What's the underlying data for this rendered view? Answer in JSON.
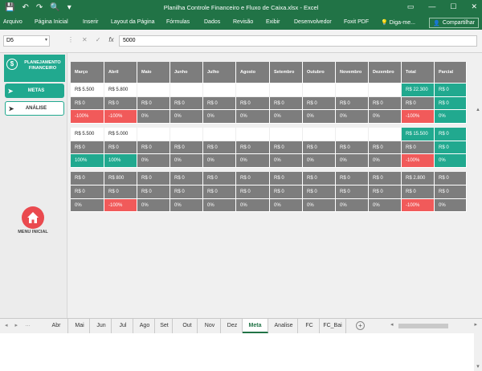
{
  "window": {
    "title": "Planilha Controle Financeiro e Fluxo de Caixa.xlsx - Excel",
    "qat": [
      "💾",
      "↶",
      "↷",
      "🔍",
      "▾"
    ],
    "controls": [
      "▭",
      "—",
      "☐",
      "✕"
    ]
  },
  "ribbon": {
    "tabs": [
      "Arquivo",
      "Página Inicial",
      "Inserir",
      "Layout da Página",
      "Fórmulas",
      "Dados",
      "Revisão",
      "Exibir",
      "Desenvolvedor",
      "Foxit PDF",
      "Diga-me..."
    ],
    "share_label": "Compartilhar"
  },
  "formula_bar": {
    "name_box": "D5",
    "icons": [
      "⋮",
      "✕",
      "✓",
      "fx"
    ],
    "value": "5000"
  },
  "panel": {
    "brand": "PLANEJAMENTO FINANCEIRO",
    "metas_label": "METAS",
    "analise_label": "ANÁLISE",
    "menu_label": "MENU INICIAL"
  },
  "table": {
    "headers": [
      "Março",
      "Abril",
      "Maio",
      "Junho",
      "Julho",
      "Agosto",
      "Setembro",
      "Outubro",
      "Novembro",
      "Dezembro",
      "Total",
      "Parcial"
    ],
    "groups": [
      [
        {
          "cells": [
            "R$ 5.500",
            "R$ 5.800",
            "",
            "",
            "",
            "",
            "",
            "",
            "",
            "",
            "R$ 22.300",
            "R$ 0"
          ],
          "styles": [
            "w",
            "w",
            "w",
            "w",
            "w",
            "w",
            "w",
            "w",
            "w",
            "w",
            "t",
            "t"
          ]
        },
        {
          "cells": [
            "R$ 0",
            "R$ 0",
            "R$ 0",
            "R$ 0",
            "R$ 0",
            "R$ 0",
            "R$ 0",
            "R$ 0",
            "R$ 0",
            "R$ 0",
            "R$ 0",
            "R$ 0"
          ],
          "styles": [
            "g",
            "g",
            "g",
            "g",
            "g",
            "g",
            "g",
            "g",
            "g",
            "g",
            "g",
            "t"
          ]
        },
        {
          "cells": [
            "-100%",
            "-100%",
            "0%",
            "0%",
            "0%",
            "0%",
            "0%",
            "0%",
            "0%",
            "0%",
            "-100%",
            "0%"
          ],
          "styles": [
            "r",
            "r",
            "g",
            "g",
            "g",
            "g",
            "g",
            "g",
            "g",
            "g",
            "r",
            "t"
          ]
        }
      ],
      [
        {
          "cells": [
            "R$ 5.500",
            "R$ 5.000",
            "",
            "",
            "",
            "",
            "",
            "",
            "",
            "",
            "R$ 15.500",
            "R$ 0"
          ],
          "styles": [
            "w",
            "w",
            "w",
            "w",
            "w",
            "w",
            "w",
            "w",
            "w",
            "w",
            "t",
            "t"
          ]
        },
        {
          "cells": [
            "R$ 0",
            "R$ 0",
            "R$ 0",
            "R$ 0",
            "R$ 0",
            "R$ 0",
            "R$ 0",
            "R$ 0",
            "R$ 0",
            "R$ 0",
            "R$ 0",
            "R$ 0"
          ],
          "styles": [
            "g",
            "g",
            "g",
            "g",
            "g",
            "g",
            "g",
            "g",
            "g",
            "g",
            "g",
            "t"
          ]
        },
        {
          "cells": [
            "100%",
            "100%",
            "0%",
            "0%",
            "0%",
            "0%",
            "0%",
            "0%",
            "0%",
            "0%",
            "-100%",
            "0%"
          ],
          "styles": [
            "t",
            "t",
            "g",
            "g",
            "g",
            "g",
            "g",
            "g",
            "g",
            "g",
            "r",
            "t"
          ]
        }
      ],
      [
        {
          "cells": [
            "R$ 0",
            "R$ 800",
            "R$ 0",
            "R$ 0",
            "R$ 0",
            "R$ 0",
            "R$ 0",
            "R$ 0",
            "R$ 0",
            "R$ 0",
            "R$ 2.800",
            "R$ 0"
          ],
          "styles": [
            "g",
            "g",
            "g",
            "g",
            "g",
            "g",
            "g",
            "g",
            "g",
            "g",
            "g",
            "g"
          ]
        },
        {
          "cells": [
            "R$ 0",
            "R$ 0",
            "R$ 0",
            "R$ 0",
            "R$ 0",
            "R$ 0",
            "R$ 0",
            "R$ 0",
            "R$ 0",
            "R$ 0",
            "R$ 0",
            "R$ 0"
          ],
          "styles": [
            "g",
            "g",
            "g",
            "g",
            "g",
            "g",
            "g",
            "g",
            "g",
            "g",
            "g",
            "g"
          ]
        },
        {
          "cells": [
            "0%",
            "-100%",
            "0%",
            "0%",
            "0%",
            "0%",
            "0%",
            "0%",
            "0%",
            "0%",
            "-100%",
            "0%"
          ],
          "styles": [
            "g",
            "r",
            "g",
            "g",
            "g",
            "g",
            "g",
            "g",
            "g",
            "g",
            "r",
            "g"
          ]
        }
      ]
    ]
  },
  "sheet_tabs": {
    "nav": [
      "◂",
      "▸",
      "…"
    ],
    "items": [
      "Abr",
      "Mai",
      "Jun",
      "Jul",
      "Ago",
      "Set",
      "Out",
      "Nov",
      "Dez",
      "Meta",
      "Analise",
      "FC",
      "FC_Bai"
    ],
    "active": "Meta",
    "plus": "+"
  },
  "colors": {
    "excel_green": "#217346",
    "teal": "#21a98f",
    "gray": "#7d7d7d",
    "red": "#f15a5a"
  }
}
